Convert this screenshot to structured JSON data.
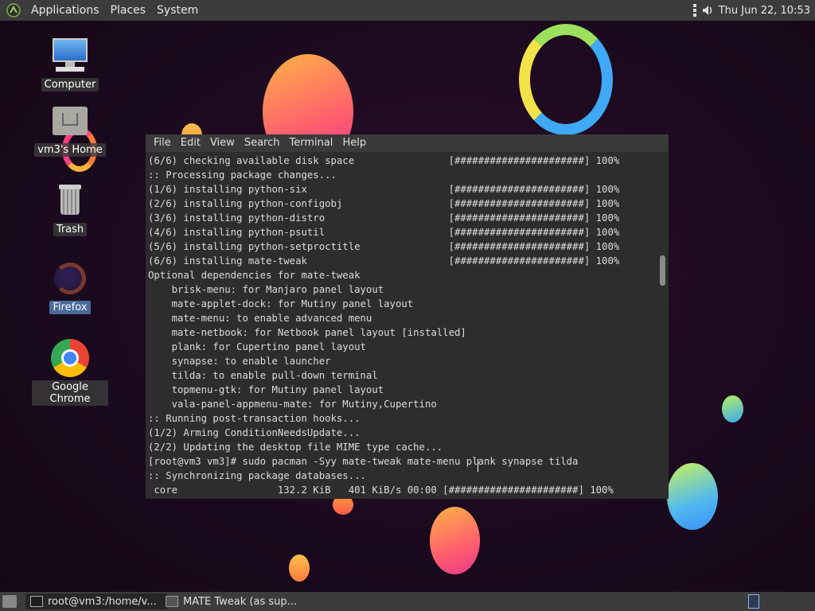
{
  "top_panel": {
    "menus": [
      "Applications",
      "Places",
      "System"
    ],
    "clock": "Thu Jun 22, 10:53"
  },
  "desktop_icons": [
    {
      "label": "Computer"
    },
    {
      "label": "vm3's Home"
    },
    {
      "label": "Trash"
    },
    {
      "label": "Firefox"
    },
    {
      "label": "Google Chrome"
    }
  ],
  "terminal": {
    "menu": [
      "File",
      "Edit",
      "View",
      "Search",
      "Terminal",
      "Help"
    ],
    "lines": [
      "(6/6) checking available disk space                [######################] 100%",
      ":: Processing package changes...",
      "(1/6) installing python-six                        [######################] 100%",
      "(2/6) installing python-configobj                  [######################] 100%",
      "(3/6) installing python-distro                     [######################] 100%",
      "(4/6) installing python-psutil                     [######################] 100%",
      "(5/6) installing python-setproctitle               [######################] 100%",
      "(6/6) installing mate-tweak                        [######################] 100%",
      "Optional dependencies for mate-tweak",
      "    brisk-menu: for Manjaro panel layout",
      "    mate-applet-dock: for Mutiny panel layout",
      "    mate-menu: to enable advanced menu",
      "    mate-netbook: for Netbook panel layout [installed]",
      "    plank: for Cupertino panel layout",
      "    synapse: to enable launcher",
      "    tilda: to enable pull-down terminal",
      "    topmenu-gtk: for Mutiny panel layout",
      "    vala-panel-appmenu-mate: for Mutiny,Cupertino",
      ":: Running post-transaction hooks...",
      "(1/2) Arming ConditionNeedsUpdate...",
      "(2/2) Updating the desktop file MIME type cache...",
      "[root@vm3 vm3]# sudo pacman -Syy mate-tweak mate-menu plank synapse tilda",
      ":: Synchronizing package databases...",
      " core                 132.2 KiB   401 KiB/s 00:00 [######################] 100%"
    ]
  },
  "taskbar": {
    "items": [
      {
        "label": "root@vm3:/home/v..."
      },
      {
        "label": "MATE Tweak (as sup..."
      }
    ]
  }
}
